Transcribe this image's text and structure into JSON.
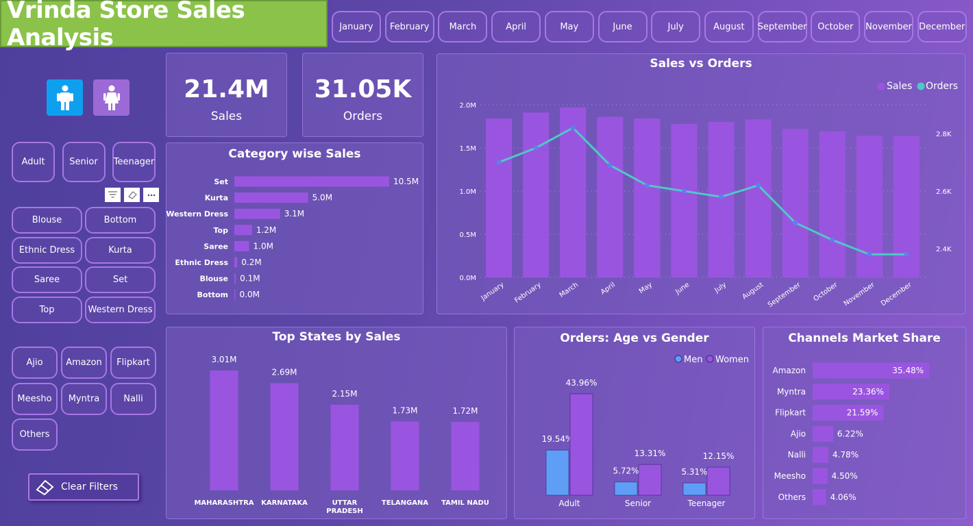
{
  "title": "Vrinda Store Sales Analysis",
  "months": [
    "January",
    "February",
    "March",
    "April",
    "May",
    "June",
    "July",
    "August",
    "September",
    "October",
    "November",
    "December"
  ],
  "gender_icons": [
    {
      "name": "male-icon",
      "color": "#0ea0ee"
    },
    {
      "name": "female-icon",
      "color": "#9c6ad6"
    }
  ],
  "age_slicer": [
    "Adult",
    "Senior",
    "Teenager"
  ],
  "category_slicer": [
    "Blouse",
    "Bottom",
    "Ethnic Dress",
    "Kurta",
    "Saree",
    "Set",
    "Top",
    "Western Dress"
  ],
  "channel_slicer": [
    "Ajio",
    "Amazon",
    "Flipkart",
    "Meesho",
    "Myntra",
    "Nalli",
    "Others"
  ],
  "slicer_tools": [
    "filter-icon",
    "eraser-icon",
    "more-icon"
  ],
  "clear_filters": "Clear Filters",
  "kpi": {
    "sales": {
      "value": "21.4M",
      "label": "Sales"
    },
    "orders": {
      "value": "31.05K",
      "label": "Orders"
    }
  },
  "colors": {
    "bar": "#9a55e0",
    "line": "#4fc8c8",
    "men": "#5f9ef7",
    "women": "#9a55e0"
  },
  "chart_data": [
    {
      "id": "category",
      "type": "bar",
      "orientation": "horizontal",
      "title": "Category wise Sales",
      "categories": [
        "Set",
        "Kurta",
        "Western Dress",
        "Top",
        "Saree",
        "Ethnic Dress",
        "Blouse",
        "Bottom"
      ],
      "values": [
        10.5,
        5.0,
        3.1,
        1.2,
        1.0,
        0.2,
        0.1,
        0.0
      ],
      "labels": [
        "10.5M",
        "5.0M",
        "3.1M",
        "1.2M",
        "1.0M",
        "0.2M",
        "0.1M",
        "0.0M"
      ],
      "max": 10.5
    },
    {
      "id": "sales_orders",
      "type": "bar+line",
      "title": "Sales vs Orders",
      "categories": [
        "January",
        "February",
        "March",
        "April",
        "May",
        "June",
        "July",
        "August",
        "September",
        "October",
        "November",
        "December"
      ],
      "series": [
        {
          "name": "Sales",
          "type": "bar",
          "axis": "left",
          "values": [
            1.84,
            1.91,
            1.97,
            1.86,
            1.84,
            1.78,
            1.8,
            1.83,
            1.72,
            1.69,
            1.64,
            1.64
          ]
        },
        {
          "name": "Orders",
          "type": "line",
          "axis": "right",
          "values": [
            2.7,
            2.75,
            2.82,
            2.69,
            2.62,
            2.6,
            2.58,
            2.62,
            2.49,
            2.43,
            2.38,
            2.38
          ]
        }
      ],
      "y_left": {
        "ticks": [
          "0.0M",
          "0.5M",
          "1.0M",
          "1.5M",
          "2.0M"
        ],
        "range": [
          0,
          2.0
        ]
      },
      "y_right": {
        "ticks": [
          "2.4K",
          "2.6K",
          "2.8K"
        ],
        "range": [
          2.3,
          2.9
        ]
      },
      "legend": "top-right",
      "grid": true
    },
    {
      "id": "states",
      "type": "bar",
      "title": "Top States by Sales",
      "categories": [
        "MAHARASHTRA",
        "KARNATAKA",
        "UTTAR PRADESH",
        "TELANGANA",
        "TAMIL NADU"
      ],
      "values": [
        3.01,
        2.69,
        2.15,
        1.73,
        1.72
      ],
      "labels": [
        "3.01M",
        "2.69M",
        "2.15M",
        "1.73M",
        "1.72M"
      ]
    },
    {
      "id": "age_gender",
      "type": "bar",
      "title": "Orders: Age vs Gender",
      "categories": [
        "Adult",
        "Senior",
        "Teenager"
      ],
      "series": [
        {
          "name": "Men",
          "values": [
            19.54,
            5.72,
            5.31
          ],
          "labels": [
            "19.54%",
            "5.72%",
            "5.31%"
          ]
        },
        {
          "name": "Women",
          "values": [
            43.96,
            13.31,
            12.15
          ],
          "labels": [
            "43.96%",
            "13.31%",
            "12.15%"
          ]
        }
      ],
      "legend": "top-right"
    },
    {
      "id": "channels",
      "type": "bar",
      "orientation": "horizontal",
      "title": "Channels Market Share",
      "categories": [
        "Amazon",
        "Myntra",
        "Flipkart",
        "Ajio",
        "Nalli",
        "Meesho",
        "Others"
      ],
      "values": [
        35.48,
        23.36,
        21.59,
        6.22,
        4.78,
        4.5,
        4.06
      ],
      "labels": [
        "35.48%",
        "23.36%",
        "21.59%",
        "6.22%",
        "4.78%",
        "4.50%",
        "4.06%"
      ]
    }
  ]
}
